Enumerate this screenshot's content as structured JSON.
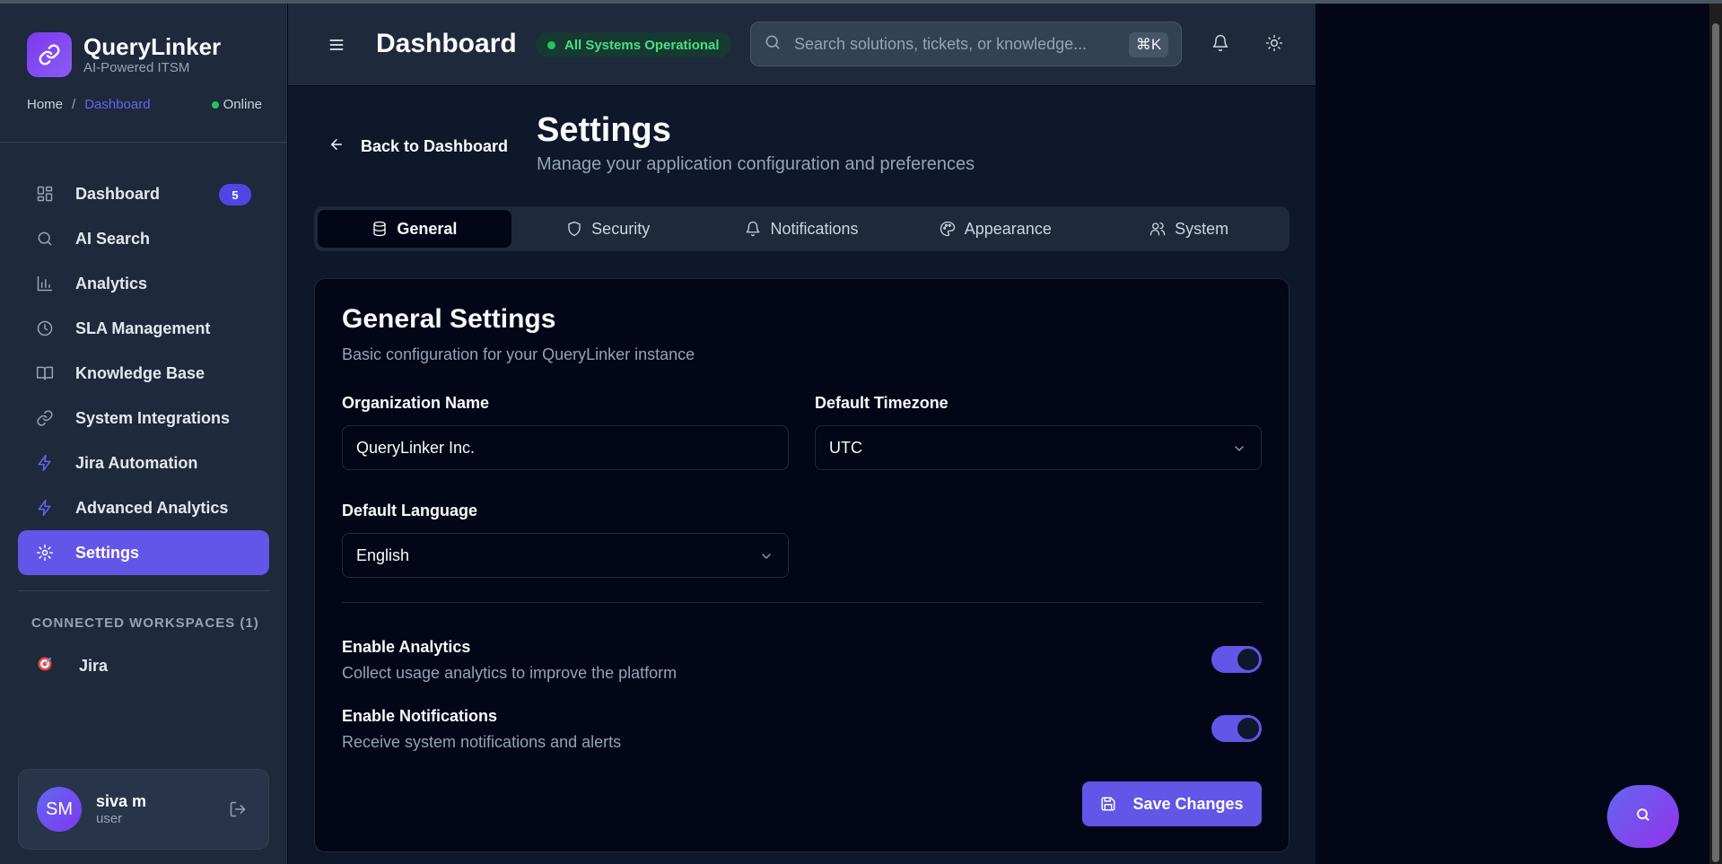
{
  "app": {
    "name": "QueryLinker",
    "subtitle": "AI-Powered ITSM",
    "logo_icon": "link-icon"
  },
  "breadcrumb": {
    "home": "Home",
    "separator": "/",
    "current": "Dashboard",
    "status": "Online"
  },
  "sidebar": {
    "items": [
      {
        "label": "Dashboard",
        "icon": "grid-icon",
        "badge": "5",
        "active": false
      },
      {
        "label": "AI Search",
        "icon": "search-icon",
        "active": false
      },
      {
        "label": "Analytics",
        "icon": "bar-chart-icon",
        "active": false
      },
      {
        "label": "SLA Management",
        "icon": "clock-icon",
        "active": false
      },
      {
        "label": "Knowledge Base",
        "icon": "book-icon",
        "active": false
      },
      {
        "label": "System Integrations",
        "icon": "link-icon",
        "active": false
      },
      {
        "label": "Jira Automation",
        "icon": "bolt-icon",
        "active": false
      },
      {
        "label": "Advanced Analytics",
        "icon": "bolt-icon",
        "active": false
      },
      {
        "label": "Settings",
        "icon": "gear-icon",
        "active": true
      }
    ],
    "workspaces_title": "CONNECTED WORKSPACES (1)",
    "workspaces": [
      {
        "label": "Jira",
        "icon": "target-icon"
      }
    ]
  },
  "user": {
    "initials": "SM",
    "name": "siva m",
    "role": "user"
  },
  "header": {
    "title": "Dashboard",
    "status": "All Systems Operational",
    "search_placeholder": "Search solutions, tickets, or knowledge...",
    "shortcut": "⌘K"
  },
  "page": {
    "back_label": "Back to Dashboard",
    "title": "Settings",
    "subtitle": "Manage your application configuration and preferences"
  },
  "tabs": [
    {
      "label": "General",
      "icon": "database-icon",
      "active": true
    },
    {
      "label": "Security",
      "icon": "shield-icon",
      "active": false
    },
    {
      "label": "Notifications",
      "icon": "bell-icon",
      "active": false
    },
    {
      "label": "Appearance",
      "icon": "palette-icon",
      "active": false
    },
    {
      "label": "System",
      "icon": "users-icon",
      "active": false
    }
  ],
  "general": {
    "title": "General Settings",
    "subtitle": "Basic configuration for your QueryLinker instance",
    "org_label": "Organization Name",
    "org_value": "QueryLinker Inc.",
    "tz_label": "Default Timezone",
    "tz_value": "UTC",
    "lang_label": "Default Language",
    "lang_value": "English",
    "analytics_label": "Enable Analytics",
    "analytics_desc": "Collect usage analytics to improve the platform",
    "analytics_on": true,
    "notify_label": "Enable Notifications",
    "notify_desc": "Receive system notifications and alerts",
    "notify_on": true,
    "save_label": "Save Changes"
  },
  "colors": {
    "accent": "#6355e8",
    "success": "#22c55e",
    "sidebar_bg": "#1e293b",
    "card_bg": "#020617"
  }
}
